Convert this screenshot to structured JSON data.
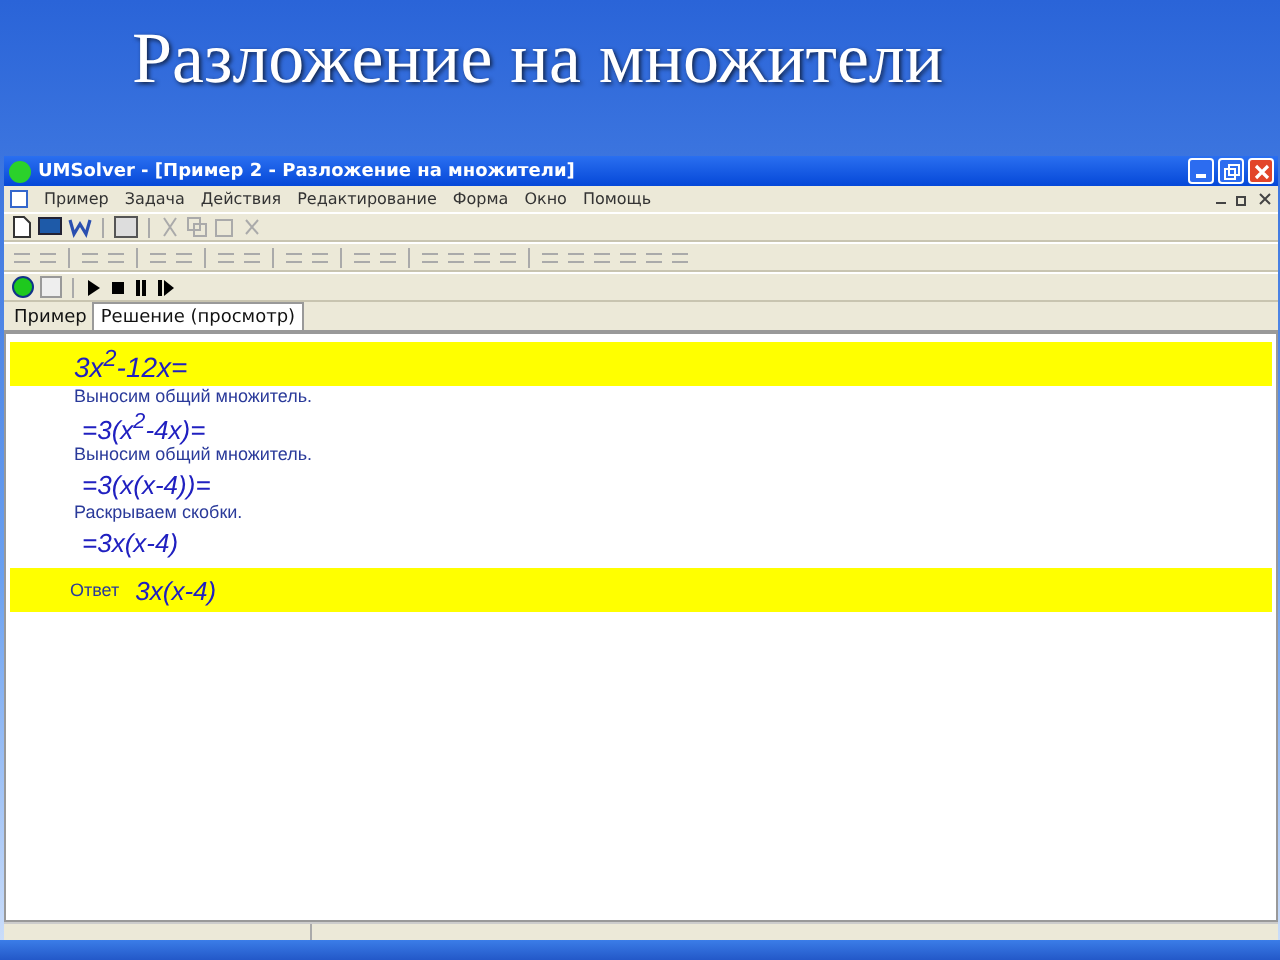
{
  "slide_title": "Разложение на множители",
  "window": {
    "title": "UMSolver - [Пример 2 - Разложение на множители]"
  },
  "menu": [
    "Пример",
    "Задача",
    "Действия",
    "Редактирование",
    "Форма",
    "Окно",
    "Помощь"
  ],
  "tabs": [
    {
      "label": "Пример",
      "selected": false
    },
    {
      "label": "Решение (просмотр)",
      "selected": true
    }
  ],
  "steps": [
    {
      "kind": "task",
      "expr": "3x$^{2}$-12x="
    },
    {
      "kind": "comment",
      "text": "Выносим общий множитель."
    },
    {
      "kind": "expr",
      "expr": "=3(x$^{2}$-4x)="
    },
    {
      "kind": "comment",
      "text": "Выносим общий множитель."
    },
    {
      "kind": "expr",
      "expr": "=3(x(x-4))="
    },
    {
      "kind": "comment",
      "text": "Раскрываем скобки."
    },
    {
      "kind": "expr",
      "expr": "=3x(x-4)"
    },
    {
      "kind": "answer",
      "label": "Ответ",
      "expr": "3x(x-4)"
    }
  ]
}
